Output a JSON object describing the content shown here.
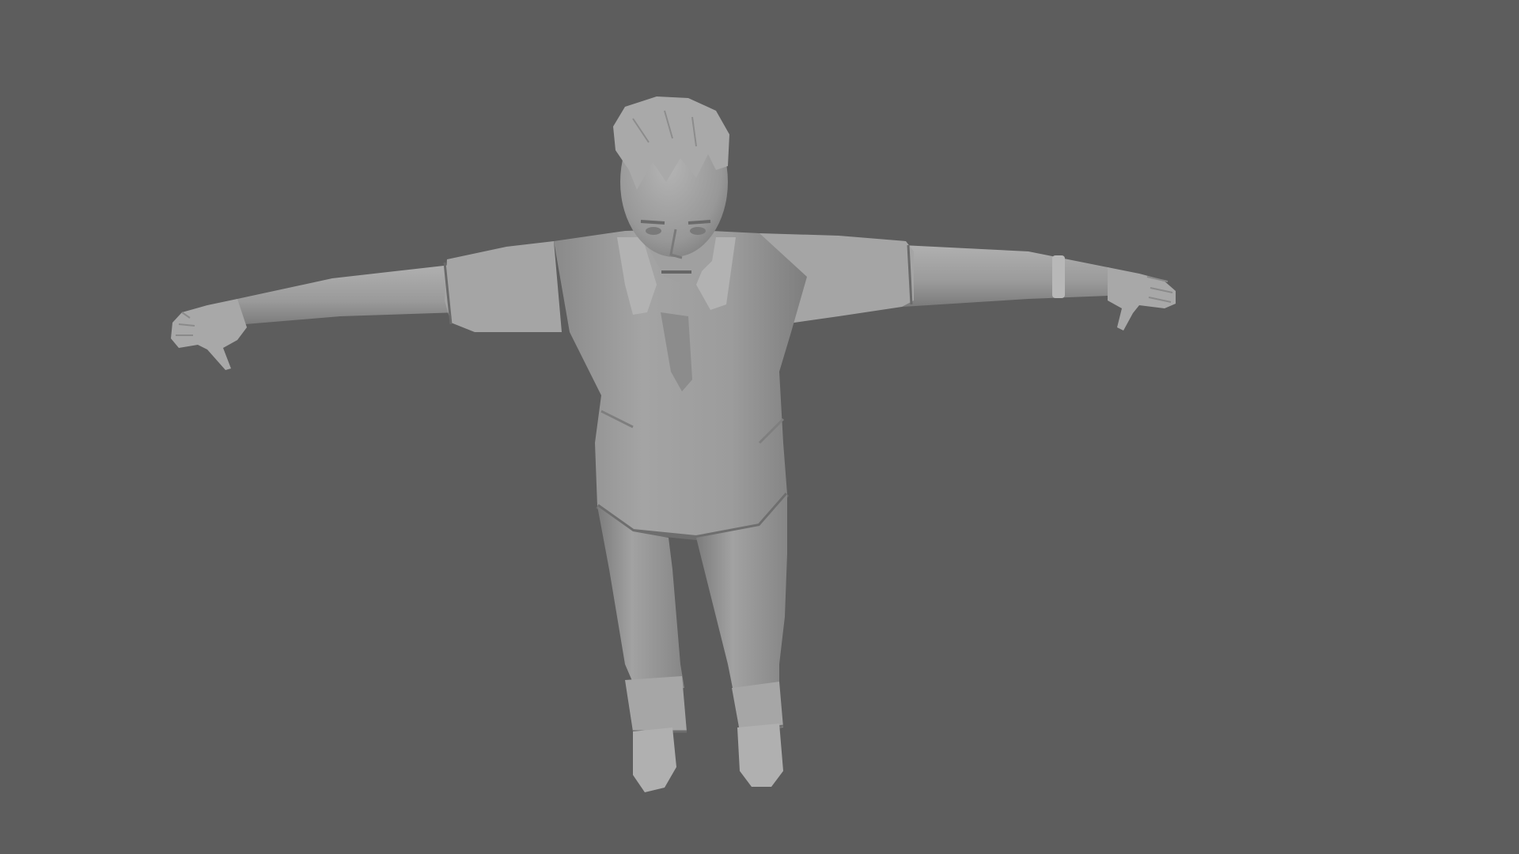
{
  "viewport": {
    "background": "#5d5d5d",
    "model_color": "#9a9a9a",
    "model_shadow": "#6e6e6e",
    "model_highlight": "#b8b8b8",
    "subject": "male-character-t-pose",
    "shading": "smooth-shaded-grey"
  }
}
